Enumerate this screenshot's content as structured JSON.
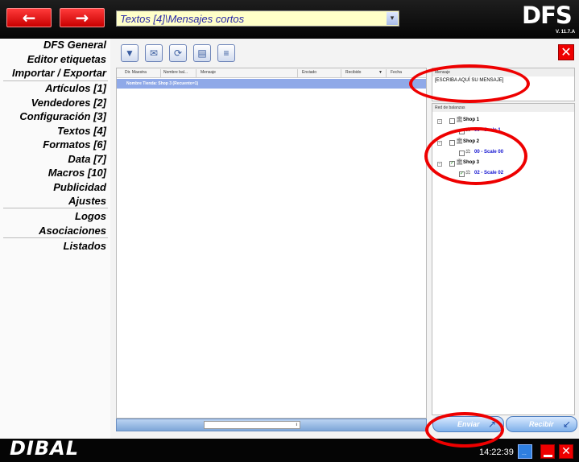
{
  "toolbar_path": "Textos [4]\\Mensajes cortos",
  "logo": "DFS",
  "version": "V. 11.7.A",
  "brand": "DIBAL",
  "nav": [
    "DFS General",
    "Editor etiquetas",
    "Importar / Exportar",
    "Artículos [1]",
    "Vendedores [2]",
    "Configuración [3]",
    "Textos [4]",
    "Formatos [6]",
    "Data [7]",
    "Macros [10]",
    "Publicidad",
    "Ajustes",
    "Logos",
    "Asociaciones",
    "Listados"
  ],
  "grid": {
    "columns": [
      "Dir. Maestra",
      "Nombre bal...",
      "Mensaje",
      "Enviado",
      "Recibido",
      "Fecha"
    ],
    "group_row": "Nombre Tienda: Shop 3 (Recuento=1)"
  },
  "message_panel": {
    "title": "Mensaje",
    "text": "[ESCRIBA AQUÍ SU MENSAJE]"
  },
  "tree": {
    "title": "Red de balanzas",
    "nodes": [
      {
        "shop": "Shop 1",
        "scale": "00 - Scale 1",
        "checked": false
      },
      {
        "shop": "Shop 2",
        "scale": "00 - Scale 00",
        "checked": false
      },
      {
        "shop": "Shop 3",
        "scale": "02 - Scale 02",
        "checked": true
      }
    ]
  },
  "buttons": {
    "send": "Enviar",
    "receive": "Recibir"
  },
  "clock": "14:22:39",
  "colors": {
    "accent_red": "#ee0000",
    "tree_link": "#1010d0",
    "grid_group": "#8fa9e8"
  }
}
